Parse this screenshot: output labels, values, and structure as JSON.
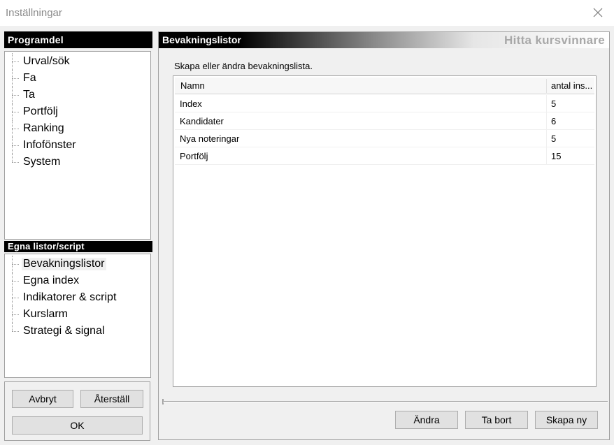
{
  "window": {
    "title": "Inställningar",
    "close_icon": "close-icon"
  },
  "programdel": {
    "header": "Programdel",
    "items": [
      {
        "label": "Urval/sök"
      },
      {
        "label": "Fa"
      },
      {
        "label": "Ta"
      },
      {
        "label": "Portfölj"
      },
      {
        "label": "Ranking"
      },
      {
        "label": "Infofönster"
      },
      {
        "label": "System"
      }
    ]
  },
  "egna": {
    "header": "Egna listor/script",
    "selected": "Bevakningslistor",
    "items": [
      {
        "label": "Bevakningslistor"
      },
      {
        "label": "Egna index"
      },
      {
        "label": "Indikatorer & script"
      },
      {
        "label": "Kurslarm"
      },
      {
        "label": "Strategi & signal"
      }
    ]
  },
  "left_buttons": {
    "cancel": "Avbryt",
    "reset": "Återställ",
    "ok": "OK"
  },
  "panel": {
    "heading": "Bevakningslistor",
    "brand": "Hitta kursvinnare",
    "description": "Skapa eller ändra bevakningslista.",
    "columns": [
      "Namn",
      "antal ins..."
    ],
    "rows": [
      {
        "name": "Index",
        "count": "5"
      },
      {
        "name": "Kandidater",
        "count": "6"
      },
      {
        "name": "Nya noteringar",
        "count": "5"
      },
      {
        "name": "Portfölj",
        "count": "15"
      }
    ],
    "buttons": {
      "edit": "Ändra",
      "delete": "Ta bort",
      "create": "Skapa ny"
    }
  },
  "colors": {
    "header_bg": "#000000",
    "brand_text": "#a8a8a8",
    "window_bg": "#f0f0f0"
  }
}
